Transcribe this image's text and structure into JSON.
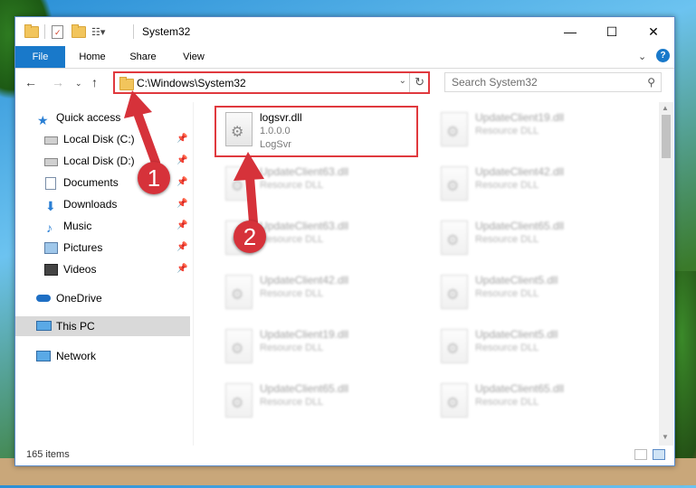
{
  "window": {
    "title": "System32"
  },
  "ribbon": {
    "tabs": [
      "File",
      "Home",
      "Share",
      "View"
    ]
  },
  "navbar": {
    "address": "C:\\Windows\\System32",
    "search_placeholder": "Search System32"
  },
  "sidebar": {
    "items": [
      {
        "label": "Quick access",
        "icon": "star-icon"
      },
      {
        "label": "Local Disk (C:)",
        "icon": "drive-icon",
        "pinned": true
      },
      {
        "label": "Local Disk (D:)",
        "icon": "drive-icon",
        "pinned": true
      },
      {
        "label": "Documents",
        "icon": "documents-icon",
        "pinned": true
      },
      {
        "label": "Downloads",
        "icon": "downloads-icon",
        "pinned": true
      },
      {
        "label": "Music",
        "icon": "music-icon",
        "pinned": true
      },
      {
        "label": "Pictures",
        "icon": "pictures-icon",
        "pinned": true
      },
      {
        "label": "Videos",
        "icon": "videos-icon",
        "pinned": true
      },
      {
        "label": "OneDrive",
        "icon": "cloud-icon"
      },
      {
        "label": "This PC",
        "icon": "computer-icon",
        "selected": true
      },
      {
        "label": "Network",
        "icon": "network-icon"
      }
    ]
  },
  "files": {
    "highlighted": {
      "name": "logsvr.dll",
      "version": "1.0.0.0",
      "description": "LogSvr"
    },
    "others": [
      {
        "name": "UpdateClient19.dll",
        "description": "Resource DLL"
      },
      {
        "name": "UpdateClient63.dll",
        "description": "Resource DLL"
      },
      {
        "name": "UpdateClient42.dll",
        "description": "Resource DLL"
      },
      {
        "name": "UpdateClient63.dll",
        "description": "Resource DLL"
      },
      {
        "name": "UpdateClient65.dll",
        "description": "Resource DLL"
      },
      {
        "name": "UpdateClient42.dll",
        "description": "Resource DLL"
      },
      {
        "name": "UpdateClient5.dll",
        "description": "Resource DLL"
      },
      {
        "name": "UpdateClient19.dll",
        "description": "Resource DLL"
      },
      {
        "name": "UpdateClient5.dll",
        "description": "Resource DLL"
      },
      {
        "name": "UpdateClient65.dll",
        "description": "Resource DLL"
      },
      {
        "name": "UpdateClient65.dll",
        "description": "Resource DLL"
      }
    ]
  },
  "status": {
    "item_count": "165 items"
  },
  "annotations": {
    "step1": "1",
    "step2": "2",
    "accent": "#e0393e"
  }
}
